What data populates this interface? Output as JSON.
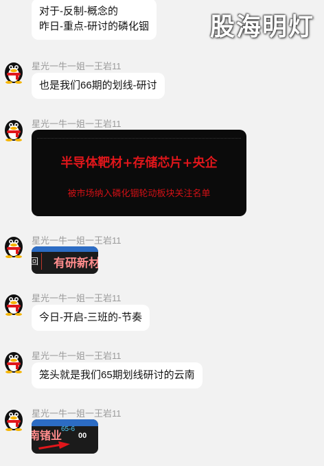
{
  "watermark": "股海明灯",
  "messages": [
    {
      "type": "text",
      "sender": "",
      "text": "对于-反制-概念的\n昨日-重点-研讨的磷化铟"
    },
    {
      "type": "text",
      "sender": "星光一牛一姐一王岩11",
      "text": "也是我们66期的划线-研讨"
    },
    {
      "type": "banner",
      "sender": "星光一牛一姐一王岩11",
      "headline": "半导体靶材+存储芯片+央企",
      "subline": "被市场纳入磷化铟轮动板块关注名单"
    },
    {
      "type": "image",
      "sender": "星光一牛一姐一王岩11",
      "left_text": "回",
      "stock": "有研新材"
    },
    {
      "type": "text",
      "sender": "星光一牛一姐一王岩11",
      "text": "今日-开启-三班的-节奏"
    },
    {
      "type": "text",
      "sender": "星光一牛一姐一王岩11",
      "text": "笼头就是我们65期划线研讨的云南"
    },
    {
      "type": "image",
      "sender": "星光一牛一姐一王岩11",
      "stock": "南锗业",
      "code": "65-6",
      "ticker": "00"
    }
  ],
  "colors": {
    "accent_red": "#e0161b",
    "bubble_bg": "#ffffff",
    "page_bg": "#f2f2f2"
  },
  "icons": {
    "avatar": "qq-penguin-icon",
    "arrow": "red-arrow-icon"
  }
}
